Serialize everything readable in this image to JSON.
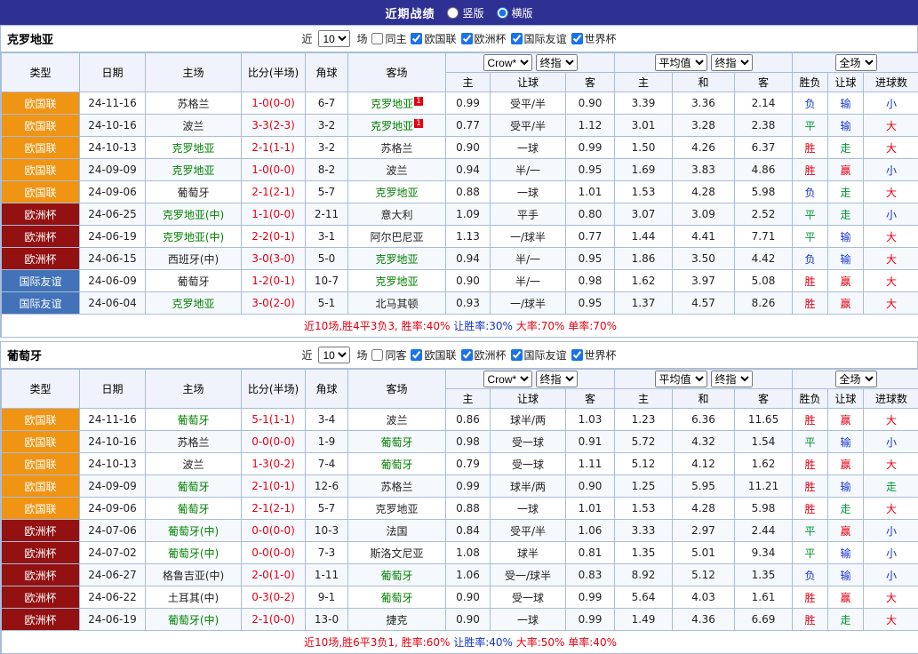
{
  "topbar": {
    "title": "近期战绩",
    "vertical_label": "竖版",
    "horizontal_label": "横版",
    "selected": "横版"
  },
  "table_header": {
    "static_columns": [
      "类型",
      "日期",
      "主场",
      "比分(半场)",
      "角球",
      "客场"
    ],
    "groups": [
      {
        "selects": [
          "Crow*",
          "终指"
        ],
        "subs": [
          "主",
          "让球",
          "客"
        ]
      },
      {
        "selects": [
          "平均值",
          "终指"
        ],
        "subs": [
          "主",
          "和",
          "客"
        ]
      },
      {
        "selects": [
          "全场"
        ],
        "subs": [
          "胜负",
          "让球",
          "进球数"
        ]
      }
    ]
  },
  "colors": {
    "topbar_bg": "#2f3192",
    "border": "#a9bcd9",
    "team_highlight": "#008000",
    "palette": {
      "red": "#e60012",
      "blue": "#1434cb",
      "green": "#009933"
    },
    "result_map": {
      "胜": "red",
      "赢": "red",
      "大": "red",
      "平": "green",
      "走": "green",
      "负": "blue",
      "输": "blue",
      "小": "blue"
    },
    "league_map": {
      "欧国联": "#ef9413",
      "欧洲杯": "#931111",
      "国际友谊": "#4272b8"
    }
  },
  "sections": [
    {
      "team": "克罗地亚",
      "filters": {
        "recent_label": "近",
        "count": "10",
        "matches_label": "场",
        "same": {
          "label": "同主",
          "checked": false
        },
        "leagues": [
          {
            "label": "欧国联",
            "checked": true
          },
          {
            "label": "欧洲杯",
            "checked": true
          },
          {
            "label": "国际友谊",
            "checked": true
          },
          {
            "label": "世界杯",
            "checked": true
          }
        ]
      },
      "rows": [
        {
          "type": "欧国联",
          "date": "24-11-16",
          "home": "苏格兰",
          "score": "1-0(0-0)",
          "corners": "6-7",
          "away": "克罗地亚",
          "away_rc": "1",
          "odds": [
            "0.99",
            "受平/半",
            "0.90"
          ],
          "avg": [
            "3.39",
            "3.36",
            "2.14"
          ],
          "results": [
            "负",
            "输",
            "小"
          ]
        },
        {
          "type": "欧国联",
          "date": "24-10-16",
          "home": "波兰",
          "score": "3-3(2-3)",
          "corners": "3-2",
          "away": "克罗地亚",
          "away_rc": "1",
          "odds": [
            "0.77",
            "受平/半",
            "1.12"
          ],
          "avg": [
            "3.01",
            "3.28",
            "2.38"
          ],
          "results": [
            "平",
            "输",
            "大"
          ]
        },
        {
          "type": "欧国联",
          "date": "24-10-13",
          "home": "克罗地亚",
          "score": "2-1(1-1)",
          "corners": "3-2",
          "away": "苏格兰",
          "odds": [
            "0.90",
            "一球",
            "0.99"
          ],
          "avg": [
            "1.50",
            "4.26",
            "6.37"
          ],
          "results": [
            "胜",
            "走",
            "大"
          ]
        },
        {
          "type": "欧国联",
          "date": "24-09-09",
          "home": "克罗地亚",
          "score": "1-0(0-0)",
          "corners": "8-2",
          "away": "波兰",
          "odds": [
            "0.94",
            "半/一",
            "0.95"
          ],
          "avg": [
            "1.69",
            "3.83",
            "4.86"
          ],
          "results": [
            "胜",
            "赢",
            "小"
          ]
        },
        {
          "type": "欧国联",
          "date": "24-09-06",
          "home": "葡萄牙",
          "score": "2-1(2-1)",
          "corners": "5-7",
          "away": "克罗地亚",
          "odds": [
            "0.88",
            "一球",
            "1.01"
          ],
          "avg": [
            "1.53",
            "4.28",
            "5.98"
          ],
          "results": [
            "负",
            "走",
            "大"
          ]
        },
        {
          "type": "欧洲杯",
          "date": "24-06-25",
          "home": "克罗地亚(中)",
          "score": "1-1(0-0)",
          "corners": "2-11",
          "away": "意大利",
          "odds": [
            "1.09",
            "平手",
            "0.80"
          ],
          "avg": [
            "3.07",
            "3.09",
            "2.52"
          ],
          "results": [
            "平",
            "走",
            "小"
          ]
        },
        {
          "type": "欧洲杯",
          "date": "24-06-19",
          "home": "克罗地亚(中)",
          "score": "2-2(0-1)",
          "corners": "3-1",
          "away": "阿尔巴尼亚",
          "odds": [
            "1.13",
            "一/球半",
            "0.77"
          ],
          "avg": [
            "1.44",
            "4.41",
            "7.71"
          ],
          "results": [
            "平",
            "输",
            "大"
          ]
        },
        {
          "type": "欧洲杯",
          "date": "24-06-15",
          "home": "西班牙(中)",
          "score": "3-0(3-0)",
          "corners": "5-0",
          "away": "克罗地亚",
          "odds": [
            "0.94",
            "半/一",
            "0.95"
          ],
          "avg": [
            "1.86",
            "3.50",
            "4.42"
          ],
          "results": [
            "负",
            "输",
            "大"
          ]
        },
        {
          "type": "国际友谊",
          "date": "24-06-09",
          "home": "葡萄牙",
          "score": "1-2(0-1)",
          "corners": "10-7",
          "away": "克罗地亚",
          "odds": [
            "0.90",
            "半/一",
            "0.98"
          ],
          "avg": [
            "1.62",
            "3.97",
            "5.08"
          ],
          "results": [
            "胜",
            "赢",
            "大"
          ]
        },
        {
          "type": "国际友谊",
          "date": "24-06-04",
          "home": "克罗地亚",
          "score": "3-0(2-0)",
          "corners": "5-1",
          "away": "北马其顿",
          "odds": [
            "0.93",
            "一/球半",
            "0.95"
          ],
          "avg": [
            "1.37",
            "4.57",
            "8.26"
          ],
          "results": [
            "胜",
            "赢",
            "大"
          ]
        }
      ],
      "summary": [
        {
          "text": "近10场,胜4平3负3, 胜率:40%",
          "color": "red"
        },
        {
          "text": " 让胜率:30%",
          "color": "blue"
        },
        {
          "text": " 大率:70%",
          "color": "red"
        },
        {
          "text": " 单率:70%",
          "color": "red"
        }
      ]
    },
    {
      "team": "葡萄牙",
      "filters": {
        "recent_label": "近",
        "count": "10",
        "matches_label": "场",
        "same": {
          "label": "同客",
          "checked": false
        },
        "leagues": [
          {
            "label": "欧国联",
            "checked": true
          },
          {
            "label": "欧洲杯",
            "checked": true
          },
          {
            "label": "国际友谊",
            "checked": true
          },
          {
            "label": "世界杯",
            "checked": true
          }
        ]
      },
      "rows": [
        {
          "type": "欧国联",
          "date": "24-11-16",
          "home": "葡萄牙",
          "score": "5-1(1-1)",
          "corners": "3-4",
          "away": "波兰",
          "odds": [
            "0.86",
            "球半/两",
            "1.03"
          ],
          "avg": [
            "1.23",
            "6.36",
            "11.65"
          ],
          "results": [
            "胜",
            "赢",
            "大"
          ]
        },
        {
          "type": "欧国联",
          "date": "24-10-16",
          "home": "苏格兰",
          "score": "0-0(0-0)",
          "corners": "1-9",
          "away": "葡萄牙",
          "odds": [
            "0.98",
            "受一球",
            "0.91"
          ],
          "avg": [
            "5.72",
            "4.32",
            "1.54"
          ],
          "results": [
            "平",
            "输",
            "小"
          ]
        },
        {
          "type": "欧国联",
          "date": "24-10-13",
          "home": "波兰",
          "score": "1-3(0-2)",
          "corners": "7-4",
          "away": "葡萄牙",
          "odds": [
            "0.79",
            "受一球",
            "1.11"
          ],
          "avg": [
            "5.12",
            "4.12",
            "1.62"
          ],
          "results": [
            "胜",
            "赢",
            "大"
          ]
        },
        {
          "type": "欧国联",
          "date": "24-09-09",
          "home": "葡萄牙",
          "score": "2-1(0-1)",
          "corners": "12-6",
          "away": "苏格兰",
          "odds": [
            "0.99",
            "球半/两",
            "0.90"
          ],
          "avg": [
            "1.25",
            "5.95",
            "11.21"
          ],
          "results": [
            "胜",
            "输",
            "走"
          ]
        },
        {
          "type": "欧国联",
          "date": "24-09-06",
          "home": "葡萄牙",
          "score": "2-1(2-1)",
          "corners": "5-7",
          "away": "克罗地亚",
          "odds": [
            "0.88",
            "一球",
            "1.01"
          ],
          "avg": [
            "1.53",
            "4.28",
            "5.98"
          ],
          "results": [
            "胜",
            "走",
            "大"
          ]
        },
        {
          "type": "欧洲杯",
          "date": "24-07-06",
          "home": "葡萄牙(中)",
          "score": "0-0(0-0)",
          "corners": "10-3",
          "away": "法国",
          "odds": [
            "0.84",
            "受平/半",
            "1.06"
          ],
          "avg": [
            "3.33",
            "2.97",
            "2.44"
          ],
          "results": [
            "平",
            "赢",
            "小"
          ]
        },
        {
          "type": "欧洲杯",
          "date": "24-07-02",
          "home": "葡萄牙(中)",
          "score": "0-0(0-0)",
          "corners": "7-3",
          "away": "斯洛文尼亚",
          "odds": [
            "1.08",
            "球半",
            "0.81"
          ],
          "avg": [
            "1.35",
            "5.01",
            "9.34"
          ],
          "results": [
            "平",
            "输",
            "小"
          ]
        },
        {
          "type": "欧洲杯",
          "date": "24-06-27",
          "home": "格鲁吉亚(中)",
          "score": "2-0(1-0)",
          "corners": "1-11",
          "away": "葡萄牙",
          "odds": [
            "1.06",
            "受一/球半",
            "0.83"
          ],
          "avg": [
            "8.92",
            "5.12",
            "1.35"
          ],
          "results": [
            "负",
            "输",
            "小"
          ]
        },
        {
          "type": "欧洲杯",
          "date": "24-06-22",
          "home": "土耳其(中)",
          "score": "0-3(0-2)",
          "corners": "9-1",
          "away": "葡萄牙",
          "odds": [
            "0.90",
            "受一球",
            "0.99"
          ],
          "avg": [
            "5.64",
            "4.03",
            "1.61"
          ],
          "results": [
            "胜",
            "赢",
            "大"
          ]
        },
        {
          "type": "欧洲杯",
          "date": "24-06-19",
          "home": "葡萄牙(中)",
          "score": "2-1(0-0)",
          "corners": "13-0",
          "away": "捷克",
          "odds": [
            "0.90",
            "一球",
            "0.99"
          ],
          "avg": [
            "1.49",
            "4.36",
            "6.69"
          ],
          "results": [
            "胜",
            "走",
            "大"
          ]
        }
      ],
      "summary": [
        {
          "text": "近10场,胜6平3负1, 胜率:60%",
          "color": "red"
        },
        {
          "text": " 让胜率:40%",
          "color": "blue"
        },
        {
          "text": " 大率:50%",
          "color": "red"
        },
        {
          "text": " 单率:40%",
          "color": "red"
        }
      ]
    }
  ]
}
